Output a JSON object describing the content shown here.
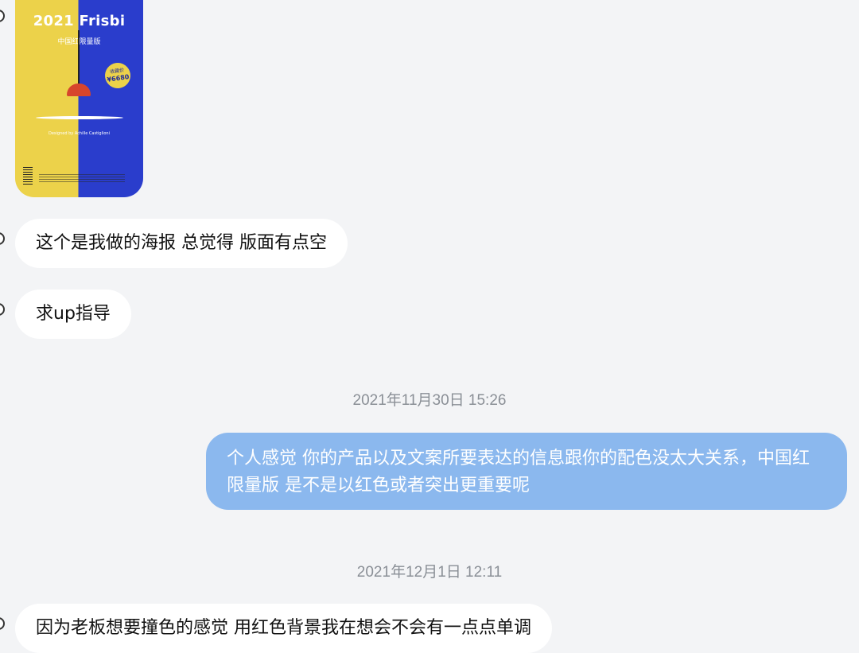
{
  "poster": {
    "title": "2021 Frisbi",
    "subtitle": "中国红限量版",
    "price_label": "收藏价",
    "price": "¥6680",
    "designer": "Designed by Achille Castiglioni",
    "colors": {
      "left": "#ecd24a",
      "right": "#2a3dcc",
      "lamp": "#d7452c"
    }
  },
  "messages": [
    {
      "side": "incoming",
      "text": "这个是我做的海报 总觉得 版面有点空"
    },
    {
      "side": "incoming",
      "text": "求up指导"
    },
    {
      "type": "timestamp",
      "text": "2021年11月30日 15:26"
    },
    {
      "side": "outgoing",
      "text": "个人感觉 你的产品以及文案所要表达的信息跟你的配色没太大关系，中国红限量版 是不是以红色或者突出更重要呢"
    },
    {
      "type": "timestamp",
      "text": "2021年12月1日 12:11"
    },
    {
      "side": "incoming",
      "text": "因为老板想要撞色的感觉 用红色背景我在想会不会有一点点单调"
    }
  ],
  "theme": {
    "background": "#f3f4f6",
    "incoming_bubble": "#ffffff",
    "outgoing_bubble": "#8bb8ee",
    "timestamp_color": "#8a8f96"
  }
}
